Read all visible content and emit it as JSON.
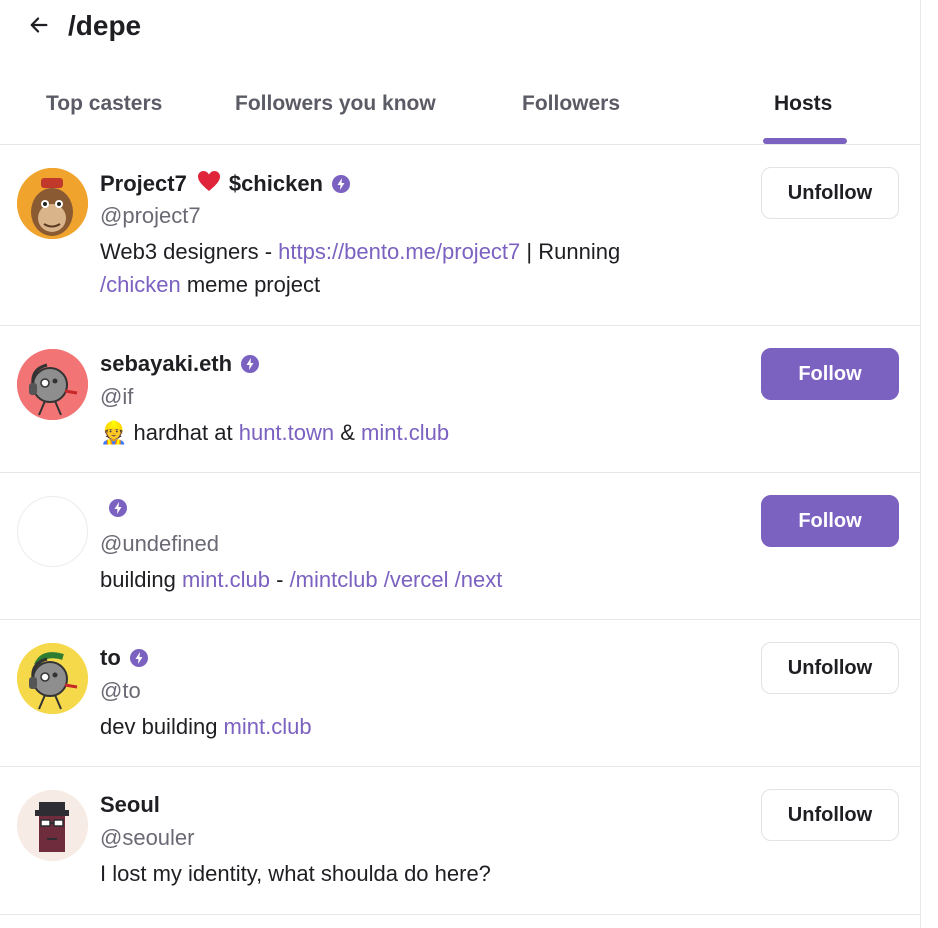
{
  "header": {
    "title": "/depe",
    "back_icon": "arrow-left-icon"
  },
  "tabs": [
    {
      "label": "Top casters",
      "active": false
    },
    {
      "label": "Followers you know",
      "active": false
    },
    {
      "label": "Followers",
      "active": false
    },
    {
      "label": "Hosts",
      "active": true
    }
  ],
  "colors": {
    "accent": "#7b61c0",
    "text": "#1f1f23",
    "muted": "#6a6a74",
    "border": "#e6e6ea"
  },
  "users": [
    {
      "name": "Project7",
      "name_suffix": "$chicken",
      "has_heart": true,
      "verified": true,
      "handle": "@project7",
      "bio_line1": {
        "pre": "Web3 designers - ",
        "link": "https://bento.me/project7",
        "post": " | Running"
      },
      "bio_line2": {
        "link": "/chicken",
        "post": " meme project"
      },
      "button": "Unfollow"
    },
    {
      "name": "sebayaki.eth",
      "verified": true,
      "handle": "@if",
      "bio": {
        "emoji": "👷",
        "pre": " hardhat at ",
        "link1": "hunt.town",
        "mid": " & ",
        "link2": "mint.club"
      },
      "button": "Follow"
    },
    {
      "name": "",
      "verified": true,
      "handle": "@undefined",
      "bio": {
        "pre": "building ",
        "link1": "mint.club",
        "mid": " - ",
        "link2": "/mintclub /vercel /next"
      },
      "button": "Follow"
    },
    {
      "name": "to",
      "verified": true,
      "handle": "@to",
      "bio": {
        "pre": "dev building ",
        "link1": "mint.club"
      },
      "button": "Unfollow"
    },
    {
      "name": "Seoul",
      "verified": false,
      "handle": "@seouler",
      "bio": {
        "pre": "I lost my identity, what shoulda do here?"
      },
      "button": "Unfollow"
    }
  ]
}
